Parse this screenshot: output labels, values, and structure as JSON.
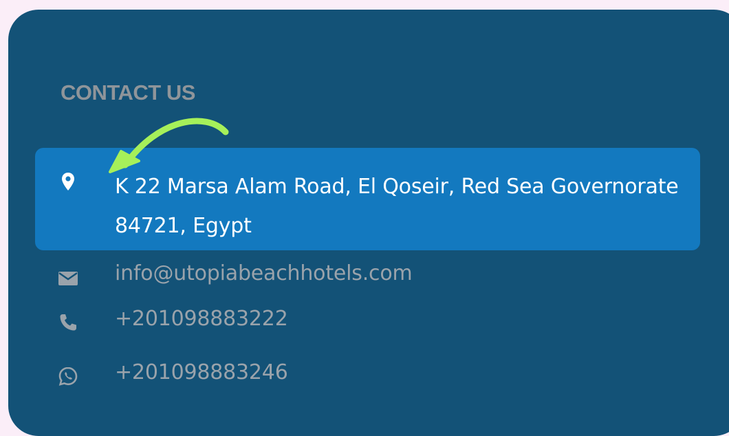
{
  "contact": {
    "heading": "CONTACT US",
    "address": "K 22 Marsa Alam Road, El Qoseir, Red Sea Governorate 84721, Egypt",
    "email": "info@utopiabeachhotels.com",
    "phone": "+201098883222",
    "whatsapp": "+201098883246"
  },
  "icons": {
    "address": "map-pin-icon",
    "email": "envelope-icon",
    "phone": "phone-icon",
    "whatsapp": "whatsapp-icon",
    "annotation": "arrow-annotation-icon"
  },
  "colors": {
    "card_background": "#135277",
    "highlight": "#1379bf",
    "arrow": "#a6f05a",
    "muted_text": "#9aa3ab"
  }
}
